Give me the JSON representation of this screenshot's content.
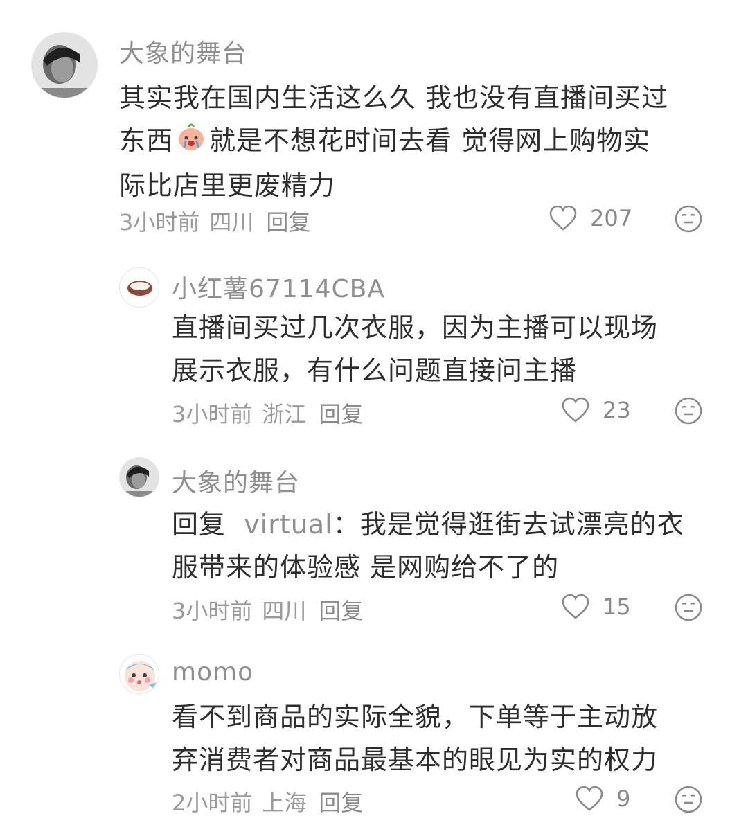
{
  "comments": [
    {
      "username": "大象的舞台",
      "content_lines": [
        "其实我在国内生活这么久 我也没有直播间买过",
        "东西",
        "就是不想花时间去看 觉得网上购物实",
        "际比店里更废精力"
      ],
      "time": "3小时前",
      "location": "四川",
      "reply": "回复",
      "likes": "207"
    },
    {
      "username": "小红薯67114CBA",
      "content_lines": [
        "直播间买过几次衣服，因为主播可以现场",
        "展示衣服，有什么问题直接问主播"
      ],
      "time": "3小时前",
      "location": "浙江",
      "reply": "回复",
      "likes": "23"
    },
    {
      "username": "大象的舞台",
      "reply_prefix": "回复",
      "mention": "virtual",
      "content_lines": [
        "：我是觉得逛街去试漂亮的衣",
        "服带来的体验感 是网购给不了的"
      ],
      "time": "3小时前",
      "location": "四川",
      "reply": "回复",
      "likes": "15"
    },
    {
      "username": "momo",
      "content_lines": [
        "看不到商品的实际全貌，下单等于主动放",
        "弃消费者对商品最基本的眼见为实的权力"
      ],
      "time": "2小时前",
      "location": "上海",
      "reply": "回复",
      "likes": "9"
    }
  ],
  "icons": {
    "like": "heart-outline-icon",
    "dislike": "meh-face-icon",
    "emoji": "crying-peach-emoji"
  }
}
